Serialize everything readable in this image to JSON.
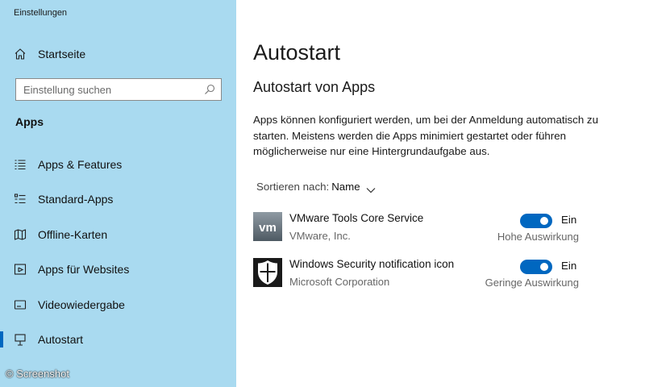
{
  "window": {
    "title": "Einstellungen"
  },
  "sidebar": {
    "home_label": "Startseite",
    "home_icon": "home-icon",
    "search": {
      "placeholder": "Einstellung suchen",
      "icon": "search-icon"
    },
    "section_header": "Apps",
    "items": [
      {
        "label": "Apps & Features",
        "icon": "apps-features-icon"
      },
      {
        "label": "Standard-Apps",
        "icon": "default-apps-icon"
      },
      {
        "label": "Offline-Karten",
        "icon": "map-icon"
      },
      {
        "label": "Apps für Websites",
        "icon": "websites-icon"
      },
      {
        "label": "Videowiedergabe",
        "icon": "video-icon"
      },
      {
        "label": "Autostart",
        "icon": "startup-icon",
        "selected": true
      }
    ],
    "background_color": "#a9daf0",
    "accent_color": "#0067c0"
  },
  "main": {
    "title": "Autostart",
    "subtitle": "Autostart von Apps",
    "description": "Apps können konfiguriert werden, um bei der Anmeldung automatisch zu starten. Meistens werden die Apps minimiert gestartet oder führen möglicherweise nur eine Hintergrundaufgabe aus.",
    "sort": {
      "label": "Sortieren nach:",
      "value": "Name"
    },
    "apps": [
      {
        "name": "VMware Tools Core Service",
        "publisher": "VMware, Inc.",
        "enabled": true,
        "state": "Ein",
        "impact": "Hohe Auswirkung",
        "icon": "vmware-icon"
      },
      {
        "name": "Windows Security notification icon",
        "publisher": "Microsoft Corporation",
        "enabled": true,
        "state": "Ein",
        "impact": "Geringe Auswirkung",
        "icon": "windows-security-shield-icon"
      }
    ]
  },
  "watermark": "© Screenshot"
}
